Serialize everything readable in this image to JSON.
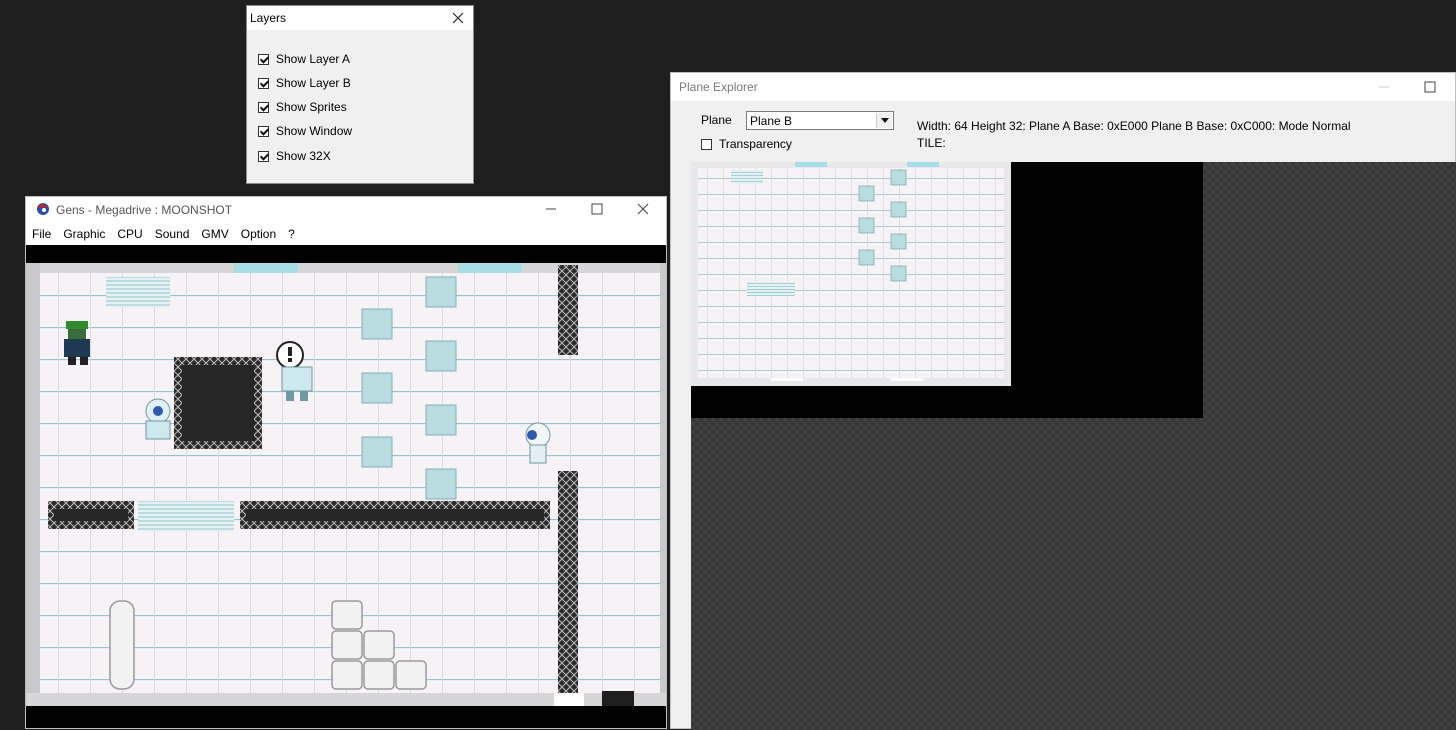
{
  "layers_window": {
    "title": "Layers",
    "options": [
      {
        "label": "Show Layer A",
        "checked": true
      },
      {
        "label": "Show Layer B",
        "checked": true
      },
      {
        "label": "Show Sprites",
        "checked": true
      },
      {
        "label": "Show Window",
        "checked": true
      },
      {
        "label": "Show 32X",
        "checked": true
      }
    ]
  },
  "gens_window": {
    "title": "Gens - Megadrive : MOONSHOT",
    "menu": [
      "File",
      "Graphic",
      "CPU",
      "Sound",
      "GMV",
      "Option",
      "?"
    ]
  },
  "plane_explorer": {
    "title": "Plane Explorer",
    "plane_label": "Plane",
    "plane_selected": "Plane B",
    "transparency_label": "Transparency",
    "transparency_checked": false,
    "info": "Width: 64 Height 32: Plane A Base: 0xE000 Plane B Base: 0xC000: Mode Normal",
    "tile_label": "TILE:"
  },
  "icons": {
    "close": "close-icon",
    "maximize": "maximize-icon",
    "minimize": "minimize-icon",
    "app": "gens-app-icon",
    "dropdown": "chevron-down-icon"
  }
}
